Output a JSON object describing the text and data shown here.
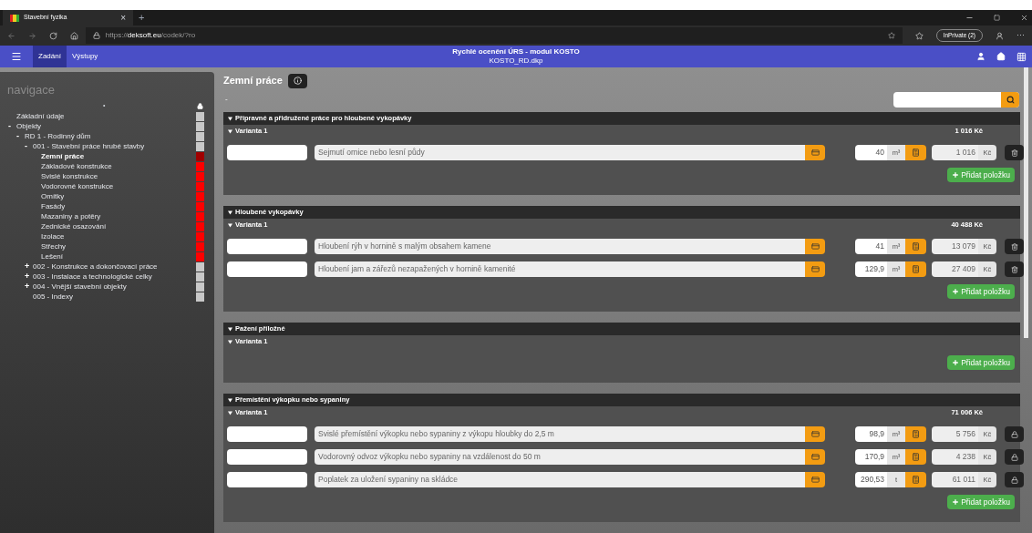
{
  "browser": {
    "tab": {
      "title": "Stavební fyzika",
      "close": "×"
    },
    "new_tab": "+",
    "url": "https://**deksoft.eu**/codek/?ro",
    "inprivate": "InPrivate (2)",
    "more": "···"
  },
  "app": {
    "tabs": [
      {
        "label": "Zadání",
        "selected": true
      },
      {
        "label": "Výstupy",
        "selected": false
      }
    ],
    "title": "Rychlé ocenění ÚRS - modul KOSTO",
    "subtitle": "KOSTO_RD.dkp"
  },
  "sidebar": {
    "title": "navigace",
    "dot": "•",
    "tree": [
      {
        "label": "Základní údaje",
        "color": "#c8c8c8",
        "selected": false
      },
      {
        "label": "Objekty",
        "toggle": "-",
        "color": "#c8c8c8",
        "selected": false,
        "children": [
          {
            "label": "RD 1 - Rodinný dům",
            "toggle": "-",
            "color": "#c8c8c8",
            "selected": false,
            "children": [
              {
                "label": "001 - Stavební práce hrubé stavby",
                "toggle": "-",
                "color": "#c8c8c8",
                "selected": false,
                "children": [
                  {
                    "label": "Zemní práce",
                    "color": "#a00000",
                    "selected": true
                  },
                  {
                    "label": "Základové konstrukce",
                    "color": "#ff0000",
                    "selected": false
                  },
                  {
                    "label": "Svislé konstrukce",
                    "color": "#ff0000",
                    "selected": false
                  },
                  {
                    "label": "Vodorovné konstrukce",
                    "color": "#ff0000",
                    "selected": false
                  },
                  {
                    "label": "Omítky",
                    "color": "#ff0000",
                    "selected": false
                  },
                  {
                    "label": "Fasády",
                    "color": "#ff0000",
                    "selected": false
                  },
                  {
                    "label": "Mazaniny a potěry",
                    "color": "#ff0000",
                    "selected": false
                  },
                  {
                    "label": "Zednické osazování",
                    "color": "#ff0000",
                    "selected": false
                  },
                  {
                    "label": "Izolace",
                    "color": "#ff0000",
                    "selected": false
                  },
                  {
                    "label": "Střechy",
                    "color": "#ff0000",
                    "selected": false
                  },
                  {
                    "label": "Lešení",
                    "color": "#ff0000",
                    "selected": false
                  }
                ]
              },
              {
                "label": "002 - Konstrukce a dokončovací práce",
                "toggle": "+",
                "color": "#c8c8c8",
                "selected": false
              },
              {
                "label": "003 - Instalace a technologické celky",
                "toggle": "+",
                "color": "#c8c8c8",
                "selected": false
              },
              {
                "label": "004 - Vnější stavební objekty",
                "toggle": "+",
                "color": "#c8c8c8",
                "selected": false
              },
              {
                "label": "005 - Indexy",
                "color": "#c8c8c8",
                "selected": false
              }
            ]
          }
        ]
      }
    ]
  },
  "main": {
    "title": "Zemní práce",
    "dash": "-",
    "sections": [
      {
        "title": "Přípravné a přidružené práce pro hloubené vykopávky",
        "variant": "Varianta 1",
        "total": "1 016 Kč",
        "add_label": "Přidat položku",
        "items": [
          {
            "description": "Sejmutí ornice nebo lesní půdy",
            "quantity": "40",
            "unit": "m³",
            "price": "1 016",
            "currency": "Kč",
            "kind": "trash"
          }
        ]
      },
      {
        "title": "Hloubené vykopávky",
        "variant": "Varianta 1",
        "total": "40 488 Kč",
        "add_label": "Přidat položku",
        "items": [
          {
            "description": "Hloubení rýh v hornině s malým obsahem kamene",
            "quantity": "41",
            "unit": "m³",
            "price": "13 079",
            "currency": "Kč",
            "kind": "trash"
          },
          {
            "description": "Hloubení jam a zářezů nezapažených v hornině kamenité",
            "quantity": "129,9",
            "unit": "m³",
            "price": "27 409",
            "currency": "Kč",
            "kind": "trash"
          }
        ]
      },
      {
        "title": "Pažení příložné",
        "variant": "Varianta 1",
        "add_label": "Přidat položku"
      },
      {
        "title": "Přemístění výkopku nebo sypaniny",
        "variant": "Varianta 1",
        "total": "71 006 Kč",
        "add_label": "Přidat položku",
        "items": [
          {
            "description": "Svislé přemístění výkopku nebo sypaniny z výkopu hloubky do 2,5 m",
            "quantity": "98,9",
            "unit": "m³",
            "price": "5 756",
            "currency": "Kč",
            "kind": "lock"
          },
          {
            "description": "Vodorovný odvoz výkopku nebo sypaniny na vzdálenost do 50 m",
            "quantity": "170,9",
            "unit": "m³",
            "price": "4 238",
            "currency": "Kč",
            "kind": "lock"
          },
          {
            "description": "Poplatek za uložení sypaniny na skládce",
            "quantity": "290,53",
            "unit": "t",
            "price": "61 011",
            "currency": "Kč",
            "kind": "lock"
          }
        ]
      }
    ]
  }
}
